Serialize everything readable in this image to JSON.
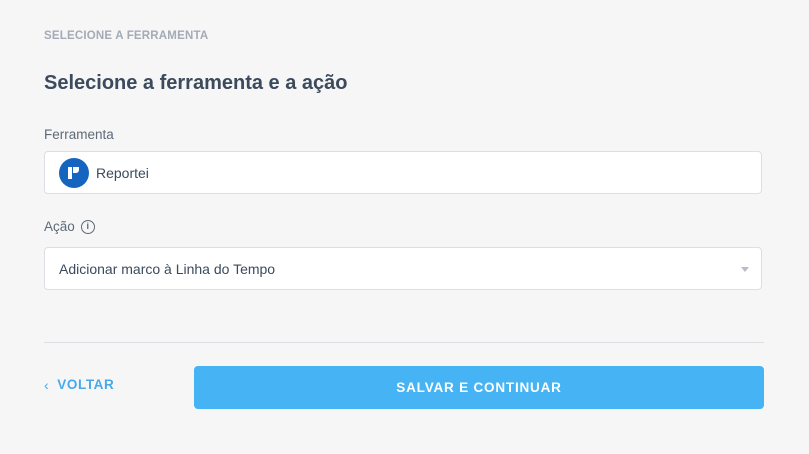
{
  "step_label": "SELECIONE A FERRAMENTA",
  "heading": "Selecione a ferramenta e a ação",
  "tool_field": {
    "label": "Ferramenta",
    "value": "Reportei",
    "logo_color": "#1565c0"
  },
  "action_field": {
    "label": "Ação",
    "info_icon": "info-icon",
    "value": "Adicionar marco à Linha do Tempo"
  },
  "buttons": {
    "back_chevron": "‹",
    "back_label": "VOLTAR",
    "save_label": "SALVAR E CONTINUAR"
  },
  "colors": {
    "accent": "#45b3f4",
    "link": "#46a9ec",
    "heading": "#3b4a5c",
    "background": "#f6f6f6"
  }
}
